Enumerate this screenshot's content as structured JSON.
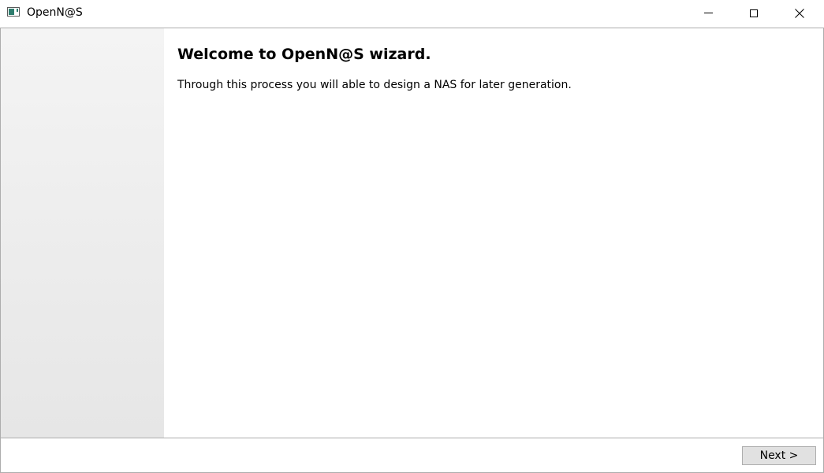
{
  "window": {
    "title": "OpenN@S",
    "icon": "app-window-icon",
    "controls": {
      "minimize_icon": "minimize-icon",
      "maximize_icon": "maximize-icon",
      "close_icon": "close-icon"
    }
  },
  "wizard": {
    "heading": "Welcome to OpenN@S wizard.",
    "description": "Through this process you will able to design a NAS for later generation."
  },
  "footer": {
    "next_label": "Next >"
  },
  "colors": {
    "border": "#adadad",
    "sidebar_top": "#f4f4f4",
    "sidebar_bottom": "#e6e6e6",
    "button_bg": "#e1e1e1",
    "icon_accent": "#2e7d6e"
  }
}
